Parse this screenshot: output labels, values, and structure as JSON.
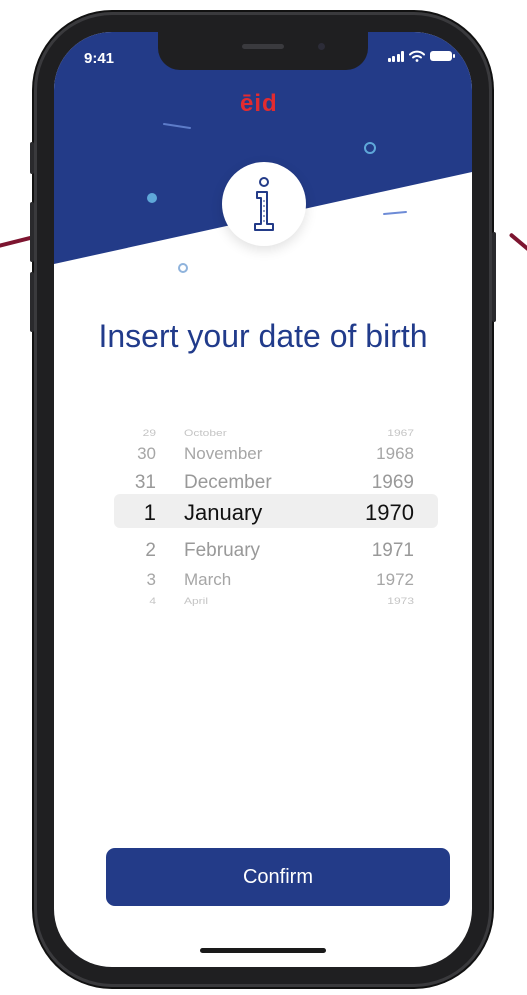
{
  "status": {
    "time": "9:41"
  },
  "brand": {
    "logo_text": "ēid",
    "primary_color": "#233b88",
    "accent_color": "#e22b2f"
  },
  "icons": {
    "hero": "info-icon"
  },
  "title": "Insert your date of birth",
  "picker": {
    "rows": [
      {
        "day": "29",
        "month": "October",
        "year": "1967"
      },
      {
        "day": "30",
        "month": "November",
        "year": "1968"
      },
      {
        "day": "31",
        "month": "December",
        "year": "1969"
      },
      {
        "day": "1",
        "month": "January",
        "year": "1970"
      },
      {
        "day": "2",
        "month": "February",
        "year": "1971"
      },
      {
        "day": "3",
        "month": "March",
        "year": "1972"
      },
      {
        "day": "4",
        "month": "April",
        "year": "1973"
      }
    ],
    "selected": {
      "day": "1",
      "month": "January",
      "year": "1970"
    }
  },
  "confirm_label": "Confirm"
}
